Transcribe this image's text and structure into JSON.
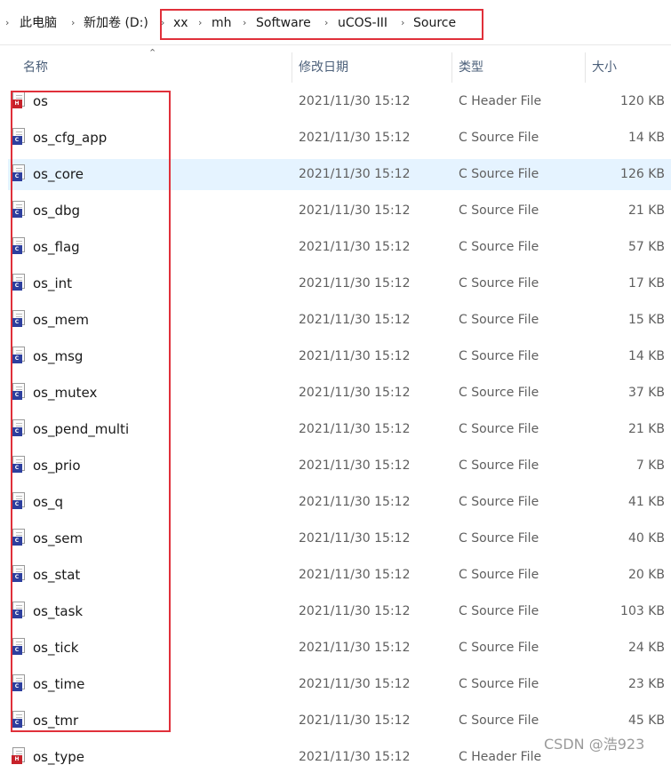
{
  "breadcrumb": {
    "items": [
      "此电脑",
      "新加卷 (D:)",
      "xx",
      "mh",
      "Software",
      "uCOS-III",
      "Source"
    ]
  },
  "columns": {
    "name": "名称",
    "modified": "修改日期",
    "type": "类型",
    "size": "大小"
  },
  "files": [
    {
      "name": "os",
      "modified": "2021/11/30 15:12",
      "type": "C Header File",
      "size": "120 KB",
      "icon": "c-header-file-icon"
    },
    {
      "name": "os_cfg_app",
      "modified": "2021/11/30 15:12",
      "type": "C Source File",
      "size": "14 KB",
      "icon": "c-source-file-icon"
    },
    {
      "name": "os_core",
      "modified": "2021/11/30 15:12",
      "type": "C Source File",
      "size": "126 KB",
      "icon": "c-source-file-icon"
    },
    {
      "name": "os_dbg",
      "modified": "2021/11/30 15:12",
      "type": "C Source File",
      "size": "21 KB",
      "icon": "c-source-file-icon"
    },
    {
      "name": "os_flag",
      "modified": "2021/11/30 15:12",
      "type": "C Source File",
      "size": "57 KB",
      "icon": "c-source-file-icon"
    },
    {
      "name": "os_int",
      "modified": "2021/11/30 15:12",
      "type": "C Source File",
      "size": "17 KB",
      "icon": "c-source-file-icon"
    },
    {
      "name": "os_mem",
      "modified": "2021/11/30 15:12",
      "type": "C Source File",
      "size": "15 KB",
      "icon": "c-source-file-icon"
    },
    {
      "name": "os_msg",
      "modified": "2021/11/30 15:12",
      "type": "C Source File",
      "size": "14 KB",
      "icon": "c-source-file-icon"
    },
    {
      "name": "os_mutex",
      "modified": "2021/11/30 15:12",
      "type": "C Source File",
      "size": "37 KB",
      "icon": "c-source-file-icon"
    },
    {
      "name": "os_pend_multi",
      "modified": "2021/11/30 15:12",
      "type": "C Source File",
      "size": "21 KB",
      "icon": "c-source-file-icon"
    },
    {
      "name": "os_prio",
      "modified": "2021/11/30 15:12",
      "type": "C Source File",
      "size": "7 KB",
      "icon": "c-source-file-icon"
    },
    {
      "name": "os_q",
      "modified": "2021/11/30 15:12",
      "type": "C Source File",
      "size": "41 KB",
      "icon": "c-source-file-icon"
    },
    {
      "name": "os_sem",
      "modified": "2021/11/30 15:12",
      "type": "C Source File",
      "size": "40 KB",
      "icon": "c-source-file-icon"
    },
    {
      "name": "os_stat",
      "modified": "2021/11/30 15:12",
      "type": "C Source File",
      "size": "20 KB",
      "icon": "c-source-file-icon"
    },
    {
      "name": "os_task",
      "modified": "2021/11/30 15:12",
      "type": "C Source File",
      "size": "103 KB",
      "icon": "c-source-file-icon"
    },
    {
      "name": "os_tick",
      "modified": "2021/11/30 15:12",
      "type": "C Source File",
      "size": "24 KB",
      "icon": "c-source-file-icon"
    },
    {
      "name": "os_time",
      "modified": "2021/11/30 15:12",
      "type": "C Source File",
      "size": "23 KB",
      "icon": "c-source-file-icon"
    },
    {
      "name": "os_tmr",
      "modified": "2021/11/30 15:12",
      "type": "C Source File",
      "size": "45 KB",
      "icon": "c-source-file-icon"
    },
    {
      "name": "os_type",
      "modified": "2021/11/30 15:12",
      "type": "C Header File",
      "size": "",
      "icon": "c-header-file-icon"
    }
  ],
  "selected_index": 2,
  "watermark": "CSDN @浩923",
  "colors": {
    "highlight_box": "#e0303a",
    "selection": "#e5f3ff",
    "c_source_badge": "#2d3f9e",
    "c_header_badge": "#c7222b"
  }
}
